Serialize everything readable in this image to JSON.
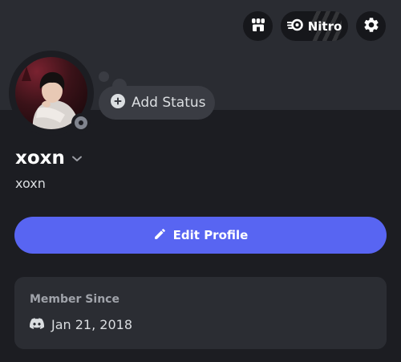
{
  "header": {
    "nitro_label": "Nitro",
    "icons": [
      "shop-icon",
      "nitro-icon",
      "gear-icon"
    ]
  },
  "profile": {
    "display_name": "xoxn",
    "username": "xoxn",
    "status_state": "offline",
    "status_color": "#80848e"
  },
  "status_prompt": {
    "label": "Add Status"
  },
  "actions": {
    "edit_profile_label": "Edit Profile",
    "accent": "#5865f2"
  },
  "member_since": {
    "title": "Member Since",
    "date": "Jan 21, 2018",
    "icon": "discord-icon"
  }
}
